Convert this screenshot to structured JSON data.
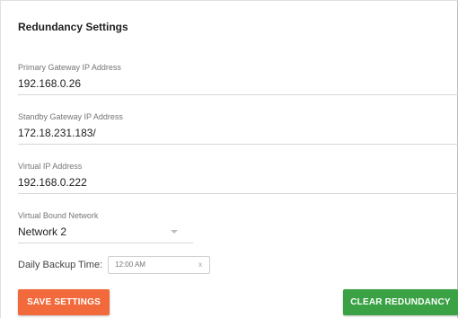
{
  "panel": {
    "title": "Redundancy Settings"
  },
  "fields": {
    "primary": {
      "label": "Primary Gateway IP Address",
      "value": "192.168.0.26"
    },
    "standby": {
      "label": "Standby Gateway IP Address",
      "value": "172.18.231.183/"
    },
    "virtual": {
      "label": "Virtual IP Address",
      "value": "192.168.0.222"
    },
    "network": {
      "label": "Virtual Bound Network",
      "value": "Network 2"
    }
  },
  "backup": {
    "label": "Daily Backup Time:",
    "time": "12:00 AM",
    "clear": "x"
  },
  "buttons": {
    "save": "SAVE SETTINGS",
    "clear": "CLEAR REDUNDANCY"
  },
  "colors": {
    "save": "#f26a3b",
    "clear": "#3aa244"
  },
  "icons": {
    "select_caret": "chevron-down-icon",
    "time_clear": "close-icon"
  }
}
